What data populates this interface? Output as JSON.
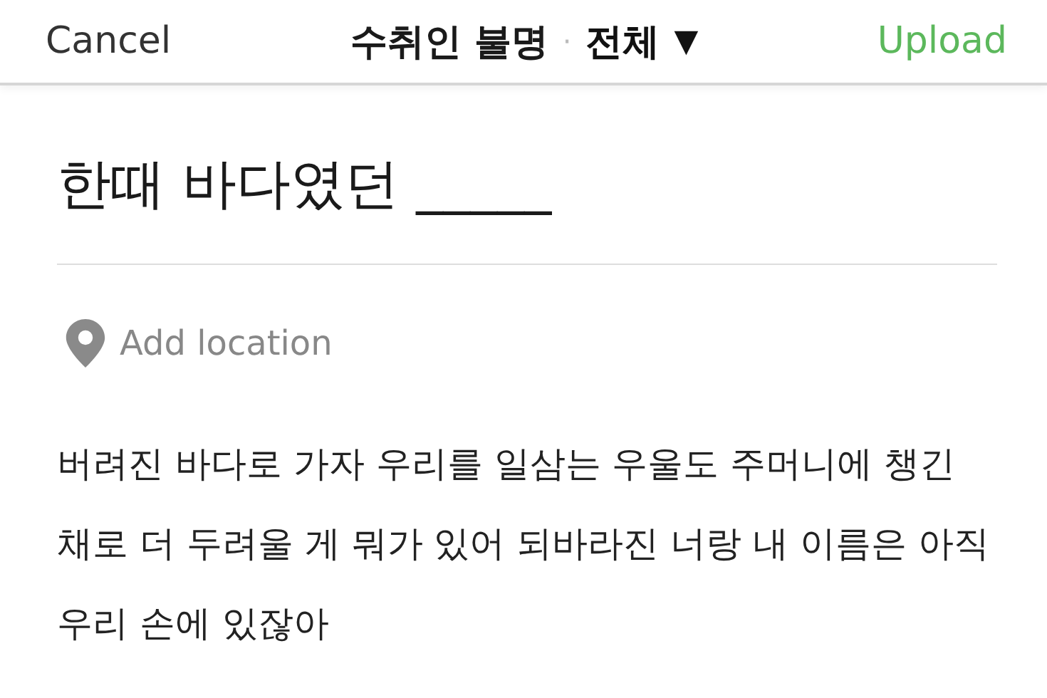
{
  "header": {
    "cancel": "Cancel",
    "recipient": "수취인 불명",
    "separator": "·",
    "audience": "전체",
    "dropdown_arrow": "▼",
    "upload": "Upload"
  },
  "title": "한때 바다였던 _____",
  "location": {
    "placeholder": "Add location"
  },
  "body": "버려진 바다로 가자 우리를 일삼는 우울도 주머니에 챙긴 채로 더 두려울 게 뭐가 있어 되바라진 너랑 내 이름은 아직 우리 손에 있잖아"
}
